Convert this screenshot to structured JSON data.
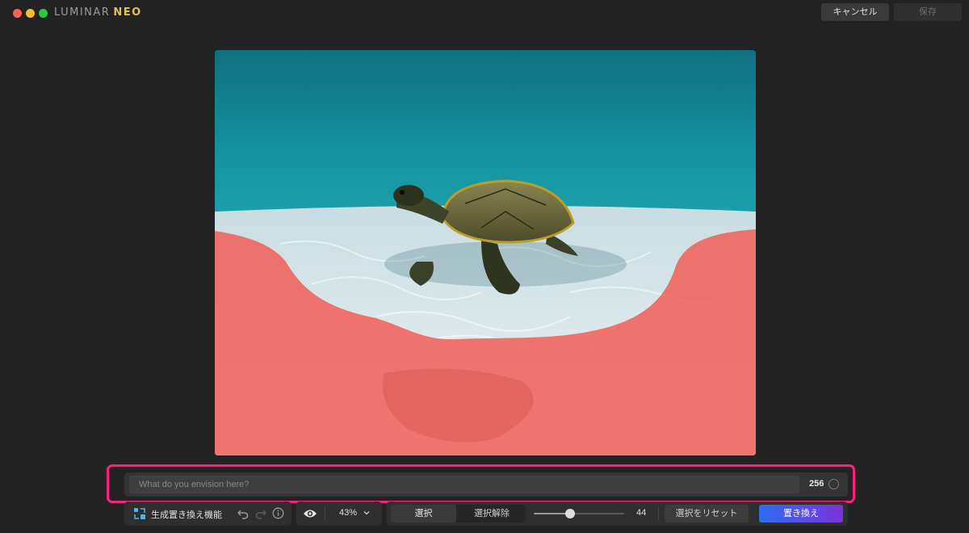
{
  "window": {
    "brand_primary": "LUMINAR",
    "brand_secondary": "NEO",
    "cancel_label": "キャンセル",
    "save_label": "保存"
  },
  "canvas": {
    "mask_color": "#f0625c"
  },
  "prompt": {
    "placeholder": "What do you envision here?",
    "value": "",
    "char_count": "256"
  },
  "toolbar": {
    "tool_name": "生成置き換え機能",
    "zoom": "43%",
    "select_label": "選択",
    "deselect_label": "選択解除",
    "brush_size": "44",
    "brush_size_fraction": 0.4,
    "reset_label": "選択をリセット",
    "replace_label": "置き換え"
  },
  "colors": {
    "highlight_border": "#ff1f7d",
    "replace_gradient_start": "#2f6cf0",
    "replace_gradient_end": "#7a34d6"
  }
}
